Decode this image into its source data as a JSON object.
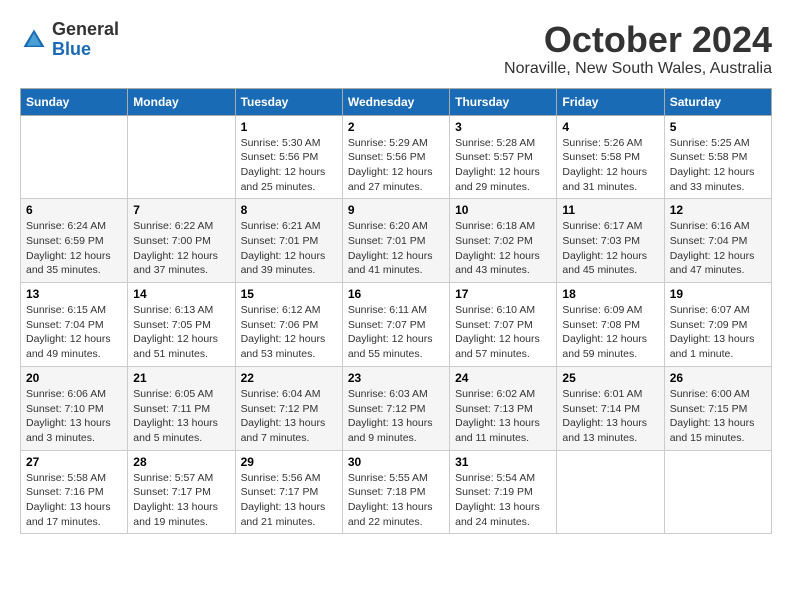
{
  "header": {
    "logo_general": "General",
    "logo_blue": "Blue",
    "month_title": "October 2024",
    "location": "Noraville, New South Wales, Australia"
  },
  "days_of_week": [
    "Sunday",
    "Monday",
    "Tuesday",
    "Wednesday",
    "Thursday",
    "Friday",
    "Saturday"
  ],
  "weeks": [
    [
      {
        "day": "",
        "content": ""
      },
      {
        "day": "",
        "content": ""
      },
      {
        "day": "1",
        "content": "Sunrise: 5:30 AM\nSunset: 5:56 PM\nDaylight: 12 hours\nand 25 minutes."
      },
      {
        "day": "2",
        "content": "Sunrise: 5:29 AM\nSunset: 5:56 PM\nDaylight: 12 hours\nand 27 minutes."
      },
      {
        "day": "3",
        "content": "Sunrise: 5:28 AM\nSunset: 5:57 PM\nDaylight: 12 hours\nand 29 minutes."
      },
      {
        "day": "4",
        "content": "Sunrise: 5:26 AM\nSunset: 5:58 PM\nDaylight: 12 hours\nand 31 minutes."
      },
      {
        "day": "5",
        "content": "Sunrise: 5:25 AM\nSunset: 5:58 PM\nDaylight: 12 hours\nand 33 minutes."
      }
    ],
    [
      {
        "day": "6",
        "content": "Sunrise: 6:24 AM\nSunset: 6:59 PM\nDaylight: 12 hours\nand 35 minutes."
      },
      {
        "day": "7",
        "content": "Sunrise: 6:22 AM\nSunset: 7:00 PM\nDaylight: 12 hours\nand 37 minutes."
      },
      {
        "day": "8",
        "content": "Sunrise: 6:21 AM\nSunset: 7:01 PM\nDaylight: 12 hours\nand 39 minutes."
      },
      {
        "day": "9",
        "content": "Sunrise: 6:20 AM\nSunset: 7:01 PM\nDaylight: 12 hours\nand 41 minutes."
      },
      {
        "day": "10",
        "content": "Sunrise: 6:18 AM\nSunset: 7:02 PM\nDaylight: 12 hours\nand 43 minutes."
      },
      {
        "day": "11",
        "content": "Sunrise: 6:17 AM\nSunset: 7:03 PM\nDaylight: 12 hours\nand 45 minutes."
      },
      {
        "day": "12",
        "content": "Sunrise: 6:16 AM\nSunset: 7:04 PM\nDaylight: 12 hours\nand 47 minutes."
      }
    ],
    [
      {
        "day": "13",
        "content": "Sunrise: 6:15 AM\nSunset: 7:04 PM\nDaylight: 12 hours\nand 49 minutes."
      },
      {
        "day": "14",
        "content": "Sunrise: 6:13 AM\nSunset: 7:05 PM\nDaylight: 12 hours\nand 51 minutes."
      },
      {
        "day": "15",
        "content": "Sunrise: 6:12 AM\nSunset: 7:06 PM\nDaylight: 12 hours\nand 53 minutes."
      },
      {
        "day": "16",
        "content": "Sunrise: 6:11 AM\nSunset: 7:07 PM\nDaylight: 12 hours\nand 55 minutes."
      },
      {
        "day": "17",
        "content": "Sunrise: 6:10 AM\nSunset: 7:07 PM\nDaylight: 12 hours\nand 57 minutes."
      },
      {
        "day": "18",
        "content": "Sunrise: 6:09 AM\nSunset: 7:08 PM\nDaylight: 12 hours\nand 59 minutes."
      },
      {
        "day": "19",
        "content": "Sunrise: 6:07 AM\nSunset: 7:09 PM\nDaylight: 13 hours\nand 1 minute."
      }
    ],
    [
      {
        "day": "20",
        "content": "Sunrise: 6:06 AM\nSunset: 7:10 PM\nDaylight: 13 hours\nand 3 minutes."
      },
      {
        "day": "21",
        "content": "Sunrise: 6:05 AM\nSunset: 7:11 PM\nDaylight: 13 hours\nand 5 minutes."
      },
      {
        "day": "22",
        "content": "Sunrise: 6:04 AM\nSunset: 7:12 PM\nDaylight: 13 hours\nand 7 minutes."
      },
      {
        "day": "23",
        "content": "Sunrise: 6:03 AM\nSunset: 7:12 PM\nDaylight: 13 hours\nand 9 minutes."
      },
      {
        "day": "24",
        "content": "Sunrise: 6:02 AM\nSunset: 7:13 PM\nDaylight: 13 hours\nand 11 minutes."
      },
      {
        "day": "25",
        "content": "Sunrise: 6:01 AM\nSunset: 7:14 PM\nDaylight: 13 hours\nand 13 minutes."
      },
      {
        "day": "26",
        "content": "Sunrise: 6:00 AM\nSunset: 7:15 PM\nDaylight: 13 hours\nand 15 minutes."
      }
    ],
    [
      {
        "day": "27",
        "content": "Sunrise: 5:58 AM\nSunset: 7:16 PM\nDaylight: 13 hours\nand 17 minutes."
      },
      {
        "day": "28",
        "content": "Sunrise: 5:57 AM\nSunset: 7:17 PM\nDaylight: 13 hours\nand 19 minutes."
      },
      {
        "day": "29",
        "content": "Sunrise: 5:56 AM\nSunset: 7:17 PM\nDaylight: 13 hours\nand 21 minutes."
      },
      {
        "day": "30",
        "content": "Sunrise: 5:55 AM\nSunset: 7:18 PM\nDaylight: 13 hours\nand 22 minutes."
      },
      {
        "day": "31",
        "content": "Sunrise: 5:54 AM\nSunset: 7:19 PM\nDaylight: 13 hours\nand 24 minutes."
      },
      {
        "day": "",
        "content": ""
      },
      {
        "day": "",
        "content": ""
      }
    ]
  ]
}
